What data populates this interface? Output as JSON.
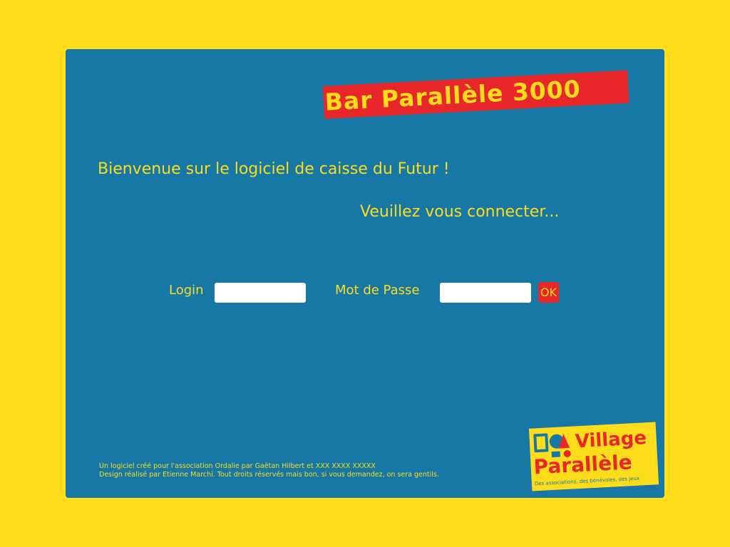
{
  "header": {
    "title": "Bar Parallèle 3000"
  },
  "main": {
    "welcome": "Bienvenue sur le logiciel de caisse du Futur !",
    "prompt": "Veuillez vous connecter..."
  },
  "form": {
    "login_label": "Login",
    "login_value": "",
    "password_label": "Mot de Passe",
    "password_value": "",
    "ok_label": "OK"
  },
  "footer": {
    "line1": "Un logiciel créé pour l'association Ordalie par Gaëtan Hilbert et XXX XXXX XXXXX",
    "line2": "Design réalisé par Etienne Marchi. Tout droits réservés mais bon, si vous demandez, on sera gentils."
  },
  "logo": {
    "word1": "Village",
    "word2": "Parallèle",
    "tagline": "Des associations, des bénévoles, des jeux"
  },
  "colors": {
    "background": "#fddd1b",
    "panel": "#1878a5",
    "accent": "#e8272b",
    "text": "#fddd1b"
  }
}
